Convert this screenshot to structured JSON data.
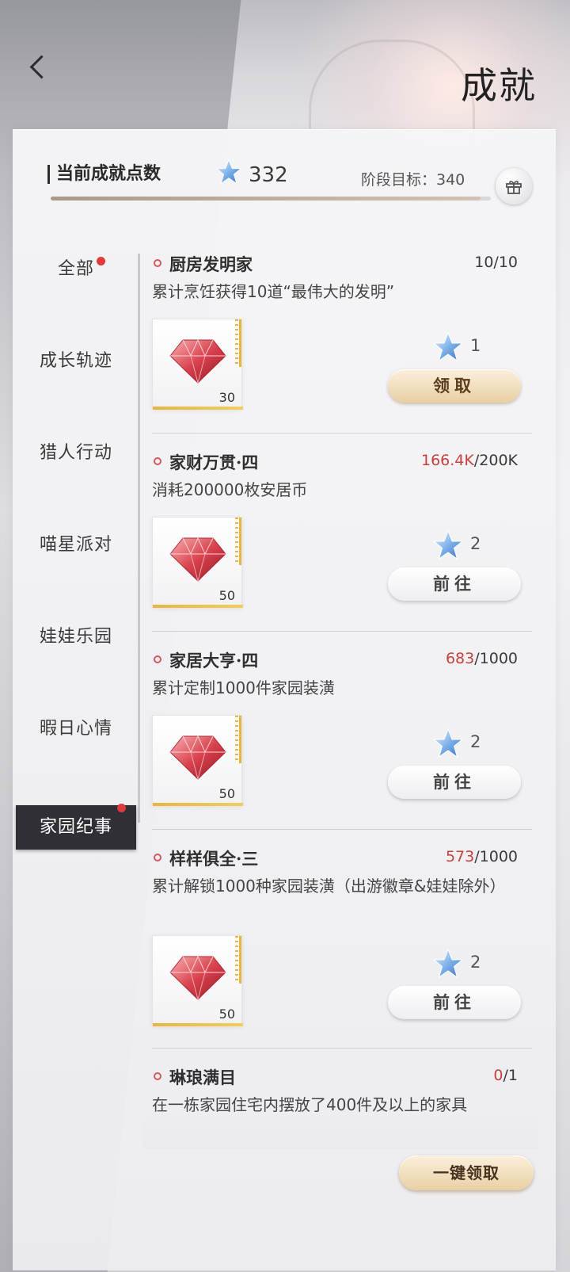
{
  "header": {
    "title": "成就"
  },
  "points": {
    "label": "当前成就点数",
    "value": "332",
    "stage_goal": "阶段目标：340",
    "progress_fraction": 0.976
  },
  "sidebar": {
    "items": [
      {
        "label": "全部",
        "active": false,
        "badge": true
      },
      {
        "label": "成长轨迹",
        "active": false,
        "badge": false
      },
      {
        "label": "猎人行动",
        "active": false,
        "badge": false
      },
      {
        "label": "喵星派对",
        "active": false,
        "badge": false
      },
      {
        "label": "娃娃乐园",
        "active": false,
        "badge": false
      },
      {
        "label": "暇日心情",
        "active": false,
        "badge": false
      },
      {
        "label": "家园纪事",
        "active": true,
        "badge": true
      }
    ]
  },
  "achievements": [
    {
      "title": "厨房发明家",
      "progress_current": "10",
      "progress_total": "10/10",
      "progress_current_highlight": false,
      "description": "累计烹饪获得10道“最伟大的发明”",
      "reward_qty": "30",
      "star_count": "1",
      "action": "领取",
      "action_style": "gold"
    },
    {
      "title": "家财万贯·四",
      "progress_current": "166.4K",
      "progress_total": "/200K",
      "progress_current_highlight": true,
      "description": "消耗200000枚安居币",
      "reward_qty": "50",
      "star_count": "2",
      "action": "前往",
      "action_style": "white"
    },
    {
      "title": "家居大亨·四",
      "progress_current": "683",
      "progress_total": "/1000",
      "progress_current_highlight": true,
      "description": "累计定制1000件家园装潢",
      "reward_qty": "50",
      "star_count": "2",
      "action": "前往",
      "action_style": "white"
    },
    {
      "title": "样样俱全·三",
      "progress_current": "573",
      "progress_total": "/1000",
      "progress_current_highlight": true,
      "description": "累计解锁1000种家园装潢（出游徽章&娃娃除外）",
      "reward_qty": "50",
      "star_count": "2",
      "action": "前往",
      "action_style": "white"
    },
    {
      "title": "琳琅满目",
      "progress_current": "0",
      "progress_total": "/1",
      "progress_current_highlight": true,
      "description": "在一栋家园住宅内摆放了400件及以上的家具"
    }
  ],
  "footer": {
    "claim_all": "一键领取"
  },
  "colors": {
    "accent_red": "#c9403c",
    "active_tab": "#2f2f35",
    "gold_button": "#e9cfa4"
  }
}
